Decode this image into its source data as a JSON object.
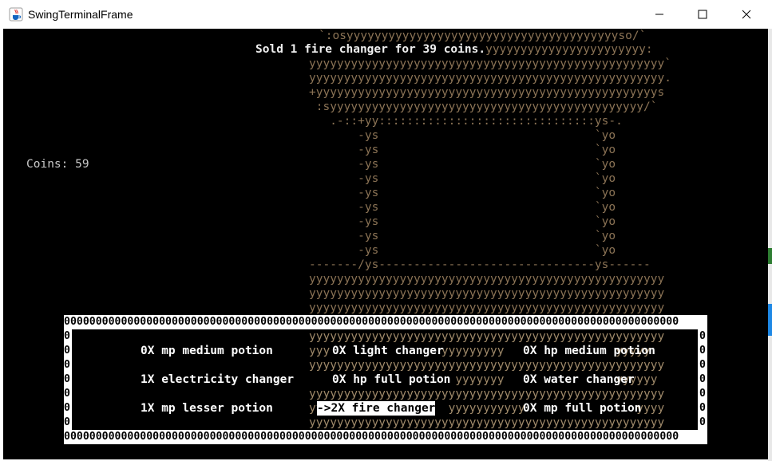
{
  "window": {
    "title": "SwingTerminalFrame",
    "icon": "java-cup-icon",
    "controls": [
      "minimize",
      "maximize",
      "close"
    ]
  },
  "message": "Sold 1 fire changer for 39 coins.",
  "coins": {
    "label": "Coins: 59"
  },
  "inventory": {
    "rows": [
      [
        {
          "text": "0X mp medium potion",
          "selected": false
        },
        {
          "text": "0X light changer",
          "selected": false
        },
        {
          "text": "0X hp medium potion",
          "selected": false
        }
      ],
      [
        {
          "text": "1X electricity changer",
          "selected": false
        },
        {
          "text": "0X hp full potion",
          "selected": false
        },
        {
          "text": "0X water changer",
          "selected": false
        }
      ],
      [
        {
          "text": "1X mp lesser potion",
          "selected": false
        },
        {
          "text": "->2X fire changer",
          "selected": true
        },
        {
          "text": "0X mp full potion",
          "selected": false
        }
      ]
    ]
  },
  "colors": {
    "background": "#000000",
    "art": "#8b7355",
    "text": "#ffffff"
  },
  "art_lines": [
    "`:osyyyyyyyyyyyyyyyyyyyyyyyyyyyyyyyyyyyyyyyso/`",
    "yyyyyyyyyyyyyyyyyyyyyyyyyyyyyyyyyyyyyyyyyyyyyyyyyyy:",
    "yyyyyyyyyyyyyyyyyyyyyyyyyyyyyyyyyyyyyyyyyyyyyyyyyyy`",
    "yyyyyyyyyyyyyyyyyyyyyyyyyyyyyyyyyyyyyyyyyyyyyyyyyyy.",
    "+yyyyyyyyyyyyyyyyyyyyyyyyyyyyyyyyyyyyyyyyyyyyyyyyys",
    " :syyyyyyyyyyyyyyyyyyyyyyyyyyyyyyyyyyyyyyyyyyyyy/`",
    "   .-::+yy:::::::::::::::::::::::::::::::ys-.",
    "       -ys                               `yo",
    "-------/ys-------------------------------ys------",
    "yyyyyyyyyyyyyyyyyyyyyyyyyyyyyyyyyyyyyyyyyyyyyyyyyyy"
  ],
  "border_char_row": "0000000000000000000000000000000000000000000000000000000000000000000000000000000000000000000000000"
}
